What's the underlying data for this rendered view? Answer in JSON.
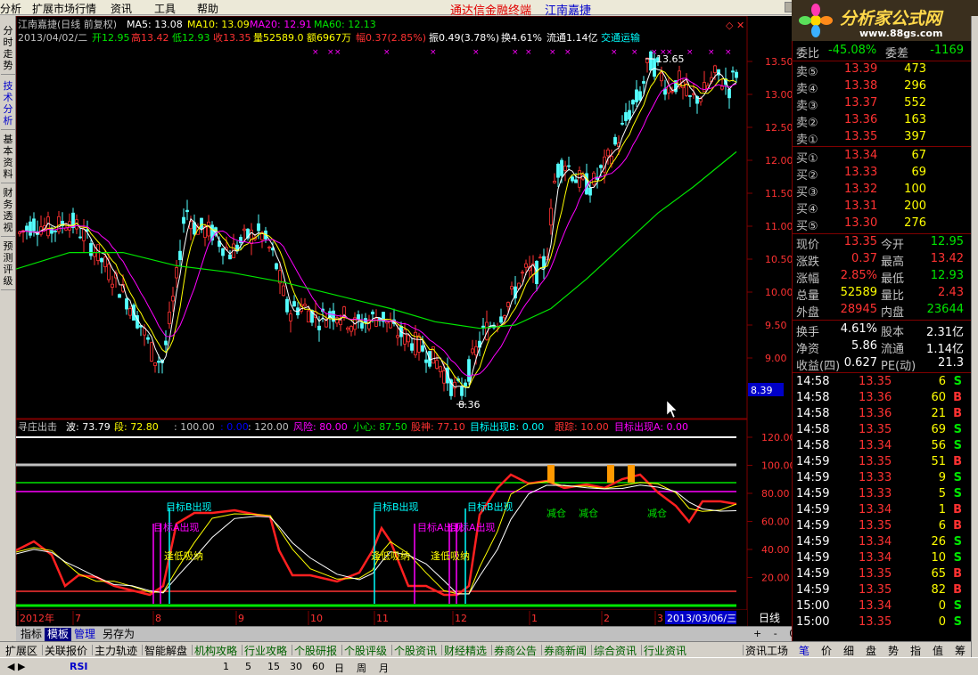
{
  "menu": {
    "items": [
      "分析",
      "扩展市场行情",
      "资讯",
      "工具",
      "帮助"
    ],
    "brand_left": "通达信金融终端",
    "brand_right": "江南嘉捷"
  },
  "logo": {
    "title": "分析家公式网",
    "url": "www.88gs.com"
  },
  "left_tabs": [
    {
      "label": "分时走势",
      "active": false
    },
    {
      "label": "技术分析",
      "active": true
    },
    {
      "label": "基本资料",
      "active": false
    },
    {
      "label": "财务透视",
      "active": false
    },
    {
      "label": "预测评级",
      "active": false
    }
  ],
  "chart_header": {
    "title": "江南嘉捷(日线 前复权)",
    "ma5": "MA5: 13.08",
    "ma10": "MA10: 13.09",
    "ma20": "MA20: 12.91",
    "ma60": "MA60: 12.13",
    "date": "2013/04/02/二",
    "open": "开12.95",
    "high": "高13.42",
    "low": "低12.93",
    "close": "收13.35",
    "vol": "量52589.0",
    "amount": "额6967万",
    "change_pct": "幅0.37(2.85%)",
    "amplitude": "振0.49(3.78%)",
    "turnover": "换4.61%",
    "float": "流通1.14亿",
    "sector": "交通运输"
  },
  "price_axis": [
    "13.50",
    "13.00",
    "12.50",
    "12.00",
    "11.50",
    "11.00",
    "10.50",
    "10.00",
    "9.50",
    "9.00"
  ],
  "price_cursor": "8.39",
  "price_annotations": {
    "high": "13.65",
    "low": "8.36"
  },
  "indicator": {
    "name": "寻庄出击",
    "bo": "波: 73.79",
    "duan": "段: 72.80",
    "v100": ": 100.00",
    "v000": ": 0.00",
    "v120": ": 120.00",
    "risk": "风险: 80.00",
    "care": "小心: 87.50",
    "god": "股神: 77.10",
    "target_b": "目标出现B: 0.00",
    "follow": "跟踪: 10.00",
    "target_a": "目标出现A: 0.00",
    "axis": [
      "120.00",
      "100.00",
      "80.00",
      "60.00",
      "40.00",
      "20.00"
    ],
    "labels": {
      "tb1": "目标B出现",
      "ta1": "目标A出现",
      "buy1": "逢低吸纳",
      "tb2": "目标B出现",
      "buy2": "逢低吸纳",
      "ta2": "目标A出现",
      "buy3": "逢低吸纳",
      "tb3": "目标B出现",
      "ta3": "目标A出现",
      "reduce1": "减仓",
      "reduce2": "减仓",
      "reduce3": "减仓"
    }
  },
  "date_axis": {
    "labels": [
      "2012年",
      "7",
      "8",
      "9",
      "10",
      "11",
      "12",
      "1",
      "2",
      "3"
    ],
    "current": "2013/03/06/三",
    "period": "日线"
  },
  "template_bar": {
    "buttons": [
      "指标",
      "模板",
      "管理",
      "另存为"
    ],
    "active": "模板",
    "zoom": [
      "+",
      "-",
      "0"
    ]
  },
  "order_book": {
    "header": {
      "a": "委比",
      "b": "-45.08%",
      "c": "委差",
      "d": "-1169"
    },
    "asks": [
      {
        "label": "卖⑤",
        "price": "13.39",
        "vol": "473"
      },
      {
        "label": "卖④",
        "price": "13.38",
        "vol": "296"
      },
      {
        "label": "卖③",
        "price": "13.37",
        "vol": "552"
      },
      {
        "label": "卖②",
        "price": "13.36",
        "vol": "163"
      },
      {
        "label": "卖①",
        "price": "13.35",
        "vol": "397"
      }
    ],
    "bids": [
      {
        "label": "买①",
        "price": "13.34",
        "vol": "67"
      },
      {
        "label": "买②",
        "price": "13.33",
        "vol": "69"
      },
      {
        "label": "买③",
        "price": "13.32",
        "vol": "100"
      },
      {
        "label": "买④",
        "price": "13.31",
        "vol": "200"
      },
      {
        "label": "买⑤",
        "price": "13.30",
        "vol": "276"
      }
    ]
  },
  "stats": [
    {
      "k1": "现价",
      "v1": "13.35",
      "c1": "red",
      "k2": "今开",
      "v2": "12.95",
      "c2": "grn"
    },
    {
      "k1": "涨跌",
      "v1": "0.37",
      "c1": "red",
      "k2": "最高",
      "v2": "13.42",
      "c2": "red"
    },
    {
      "k1": "涨幅",
      "v1": "2.85%",
      "c1": "red",
      "k2": "最低",
      "v2": "12.93",
      "c2": "grn"
    },
    {
      "k1": "总量",
      "v1": "52589",
      "c1": "yel",
      "k2": "量比",
      "v2": "2.43",
      "c2": "red"
    },
    {
      "k1": "外盘",
      "v1": "28945",
      "c1": "red",
      "k2": "内盘",
      "v2": "23644",
      "c2": "grn"
    },
    {
      "k1": "换手",
      "v1": "4.61%",
      "c1": "wht",
      "k2": "股本",
      "v2": "2.31亿",
      "c2": "wht"
    },
    {
      "k1": "净资",
      "v1": "5.86",
      "c1": "wht",
      "k2": "流通",
      "v2": "1.14亿",
      "c2": "wht"
    },
    {
      "k1": "收益(四)",
      "v1": "0.627",
      "c1": "wht",
      "k2": "PE(动)",
      "v2": "21.3",
      "c2": "wht"
    }
  ],
  "ticks": [
    {
      "t": "14:58",
      "p": "13.35",
      "v": "6",
      "s": "S"
    },
    {
      "t": "14:58",
      "p": "13.36",
      "v": "60",
      "s": "B"
    },
    {
      "t": "14:58",
      "p": "13.36",
      "v": "21",
      "s": "B"
    },
    {
      "t": "14:58",
      "p": "13.35",
      "v": "69",
      "s": "S"
    },
    {
      "t": "14:58",
      "p": "13.34",
      "v": "56",
      "s": "S"
    },
    {
      "t": "14:59",
      "p": "13.35",
      "v": "51",
      "s": "B"
    },
    {
      "t": "14:59",
      "p": "13.33",
      "v": "9",
      "s": "S"
    },
    {
      "t": "14:59",
      "p": "13.33",
      "v": "5",
      "s": "S"
    },
    {
      "t": "14:59",
      "p": "13.34",
      "v": "1",
      "s": "B"
    },
    {
      "t": "14:59",
      "p": "13.35",
      "v": "6",
      "s": "B"
    },
    {
      "t": "14:59",
      "p": "13.34",
      "v": "26",
      "s": "S"
    },
    {
      "t": "14:59",
      "p": "13.34",
      "v": "10",
      "s": "S"
    },
    {
      "t": "14:59",
      "p": "13.35",
      "v": "65",
      "s": "B"
    },
    {
      "t": "14:59",
      "p": "13.35",
      "v": "82",
      "s": "B"
    },
    {
      "t": "15:00",
      "p": "13.34",
      "v": "0",
      "s": "S"
    },
    {
      "t": "15:00",
      "p": "13.35",
      "v": "0",
      "s": "S"
    }
  ],
  "right_tabs": [
    "笔",
    "价",
    "细",
    "盘",
    "势",
    "指",
    "值",
    "筹"
  ],
  "bottom_tabs": [
    "扩展区",
    "关联报价",
    "主力轨迹",
    "智能解盘",
    "机构攻略",
    "行业攻略",
    "个股研报",
    "个股评级",
    "个股资讯",
    "财经精选",
    "券商公告",
    "券商新闻",
    "综合资讯",
    "行业资讯",
    "资讯工场"
  ],
  "status_bar": [
    "1",
    "5",
    "15",
    "30",
    "60",
    "日",
    "周",
    "月"
  ]
}
